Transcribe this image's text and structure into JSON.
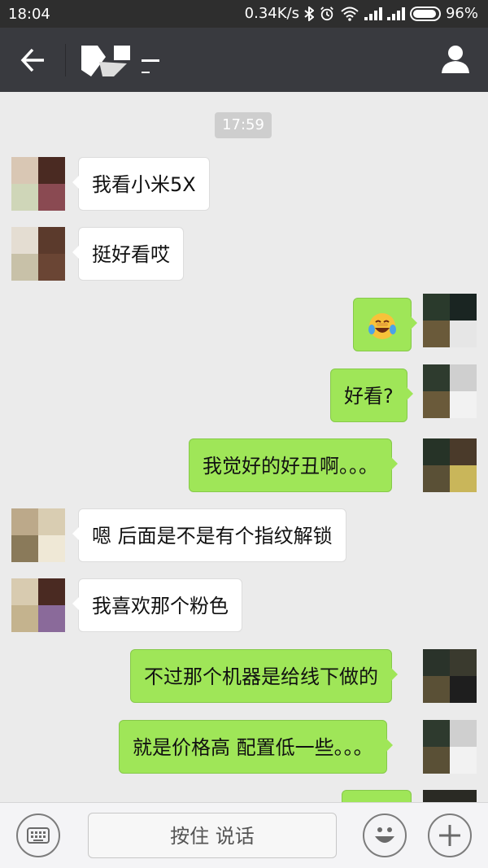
{
  "status_bar": {
    "time": "18:04",
    "network_speed": "0.34K/s",
    "battery": "96%",
    "icons": [
      "bluetooth-icon",
      "alarm-icon",
      "wifi-icon",
      "signal-icon",
      "signal-icon",
      "battery-icon"
    ]
  },
  "nav": {
    "back_icon": "back-arrow-icon",
    "profile_icon": "person-icon"
  },
  "chat": {
    "timestamp": "17:59",
    "messages": [
      {
        "side": "in",
        "text": "我看小米5X"
      },
      {
        "side": "in",
        "text": "挺好看哎"
      },
      {
        "side": "out",
        "text": "😭",
        "emoji": "crying-laughing-emoji"
      },
      {
        "side": "out",
        "text": "好看?"
      },
      {
        "side": "out",
        "text": "我觉好的好丑啊。。。"
      },
      {
        "side": "in",
        "text": "嗯 后面是不是有个指纹解锁"
      },
      {
        "side": "in",
        "text": "我喜欢那个粉色"
      },
      {
        "side": "out",
        "text": "不过那个机器是给线下做的"
      },
      {
        "side": "out",
        "text": "就是价格高 配置低一些。。。"
      }
    ]
  },
  "input_bar": {
    "hold_to_talk": "按住 说话",
    "keyboard_icon": "keyboard-icon",
    "emoji_icon": "smiley-icon",
    "add_icon": "plus-icon"
  },
  "colors": {
    "status_bar_bg": "#2e2e2e",
    "nav_bg": "#393a3f",
    "chat_bg": "#ebebeb",
    "outgoing_bubble": "#9fe658",
    "incoming_bubble": "#ffffff"
  }
}
